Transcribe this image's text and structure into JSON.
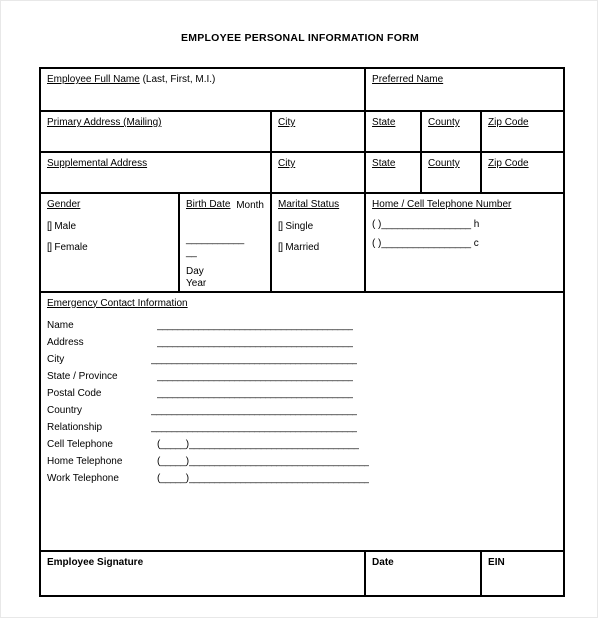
{
  "document": {
    "title": "EMPLOYEE PERSONAL INFORMATION FORM"
  },
  "name_row": {
    "full_name_label": "Employee Full Name",
    "full_name_hint": " (Last, First, M.I.)",
    "preferred_name_label": "Preferred Name"
  },
  "address_rows": [
    {
      "address_label": "Primary Address (Mailing)",
      "city_label": "City",
      "state_label": "State",
      "county_label": "County",
      "zip_label": "Zip Code"
    },
    {
      "address_label": "Supplemental Address",
      "city_label": "City",
      "state_label": "State",
      "county_label": "County",
      "zip_label": "Zip Code"
    }
  ],
  "demographics": {
    "gender": {
      "label": "Gender",
      "options": [
        "Male",
        "Female"
      ],
      "checkbox_glyph": "[]"
    },
    "birth_date": {
      "label": "Birth Date",
      "line_long": "___________",
      "line_short": "__",
      "month_label": "Month",
      "day_label": "Day",
      "year_label": "Year"
    },
    "marital_status": {
      "label": "Marital Status",
      "options": [
        "Single",
        "Married"
      ],
      "checkbox_glyph": "[]"
    },
    "telephone": {
      "label": "Home / Cell Telephone Number",
      "rows": [
        {
          "prefix": "(",
          "gap": "        ",
          "close": ")",
          "line": "_________________",
          "suffix": "h"
        },
        {
          "prefix": "(",
          "gap": "        ",
          "close": ")",
          "line": "_________________",
          "suffix": "c"
        }
      ]
    }
  },
  "emergency_contact": {
    "title": "Emergency Contact Information ",
    "rows": [
      {
        "label": "Name",
        "paren": "",
        "line": "______________________________________"
      },
      {
        "label": "Address",
        "paren": "",
        "line": "______________________________________"
      },
      {
        "label": "City",
        "paren": "",
        "line": "________________________________________"
      },
      {
        "label": "State / Province",
        "paren": "",
        "line": "______________________________________"
      },
      {
        "label": "Postal Code",
        "paren": "",
        "line": "______________________________________"
      },
      {
        "label": "Country",
        "paren": "",
        "line": "________________________________________"
      },
      {
        "label": "Relationship",
        "paren": "",
        "line": "________________________________________"
      },
      {
        "label": "Cell Telephone",
        "paren": "(_____)",
        "line": "_________________________________"
      },
      {
        "label": "Home Telephone",
        "paren": "(_____)",
        "line": "___________________________________"
      },
      {
        "label": "Work Telephone",
        "paren": "(_____)",
        "line": "___________________________________"
      }
    ]
  },
  "signature_row": {
    "signature_label": "Employee Signature",
    "date_label": "Date",
    "ein_label": "EIN"
  }
}
